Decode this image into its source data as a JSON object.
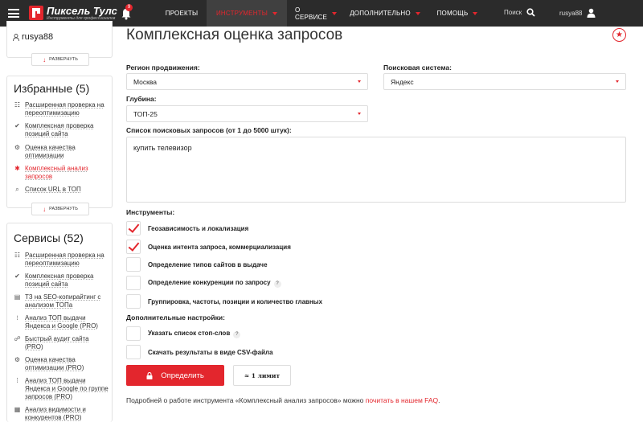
{
  "header": {
    "logo_title": "Пиксель Тулс",
    "logo_subtitle": "Инструменты для профессионалов",
    "notif_count": "9",
    "nav": [
      {
        "label": "ПРОЕКТЫ",
        "dropdown": false
      },
      {
        "label": "ИНСТРУМЕНТЫ",
        "dropdown": true,
        "active": true
      },
      {
        "label": "О СЕРВИСЕ",
        "dropdown": true
      },
      {
        "label": "ДОПОЛНИТЕЛЬНО",
        "dropdown": true
      },
      {
        "label": "ПОМОЩЬ",
        "dropdown": true
      }
    ],
    "search_label": "Поиск",
    "username": "rusya88"
  },
  "sidebar": {
    "username": "rusya88",
    "expand_label": "развернуть",
    "favorites": {
      "title": "Избранные (5)",
      "items": [
        {
          "label": "Расширенная проверка на переоптимизацию",
          "icon": "list-icon"
        },
        {
          "label": "Комплексная проверка позиций сайта",
          "icon": "check-icon"
        },
        {
          "label": "Оценка качества оптимизации",
          "icon": "gears-icon"
        },
        {
          "label": "Комплексный анализ запросов",
          "icon": "gear-icon",
          "active": true
        },
        {
          "label": "Список URL в ТОП",
          "icon": "search-icon"
        }
      ]
    },
    "services": {
      "title": "Сервисы (52)",
      "items": [
        {
          "label": "Расширенная проверка на переоптимизацию",
          "icon": "list-icon"
        },
        {
          "label": "Комплексная проверка позиций сайта",
          "icon": "check-icon"
        },
        {
          "label": "ТЗ на SEO-копирайтинг с анализом ТОПа",
          "icon": "doc-icon"
        },
        {
          "label": "Анализ ТОП выдачи Яндекса и Google (PRO)",
          "icon": "grid-icon"
        },
        {
          "label": "Быстрый аудит сайта (PRO)",
          "icon": "users-icon"
        },
        {
          "label": "Оценка качества оптимизации (PRO)",
          "icon": "gears-icon"
        },
        {
          "label": "Анализ ТОП выдачи Яндекса и Google по группе запросов (PRO)",
          "icon": "dots-icon"
        },
        {
          "label": "Анализ видимости и конкурентов (PRO)",
          "icon": "bars-icon"
        }
      ]
    }
  },
  "main": {
    "title": "Комплексная оценка запросов",
    "region_label": "Регион продвижения:",
    "region_value": "Москва",
    "engine_label": "Поисковая система:",
    "engine_value": "Яндекс",
    "depth_label": "Глубина:",
    "depth_value": "ТОП-25",
    "queries_label": "Список поисковых запросов (от 1 до 5000 штук):",
    "queries_value": "купить телевизор",
    "tools_label": "Инструменты:",
    "tools": [
      {
        "label": "Геозависимость и локализация",
        "checked": true,
        "help": false
      },
      {
        "label": "Оценка интента запроса, коммерциализация",
        "checked": true,
        "help": false
      },
      {
        "label": "Определение типов сайтов в выдаче",
        "checked": false,
        "help": false
      },
      {
        "label": "Определение конкуренции по запросу",
        "checked": false,
        "help": true
      },
      {
        "label": "Группировка, частоты, позиции и количество главных",
        "checked": false,
        "help": false
      }
    ],
    "extra_label": "Дополнительные настройки:",
    "extra": [
      {
        "label": "Указать список стоп-слов",
        "checked": false,
        "help": true
      },
      {
        "label": "Скачать результаты в виде CSV-файла",
        "checked": false,
        "help": false
      }
    ],
    "submit_label": "Определить",
    "limit_label": "≈ 1 лимит",
    "faq_text": "Подробней о работе инструмента «Комплексный анализ запросов» можно ",
    "faq_link": "почитать в нашем FAQ",
    "faq_end": "."
  },
  "colors": {
    "accent": "#e3262d",
    "topbar": "#2b2b2b"
  }
}
